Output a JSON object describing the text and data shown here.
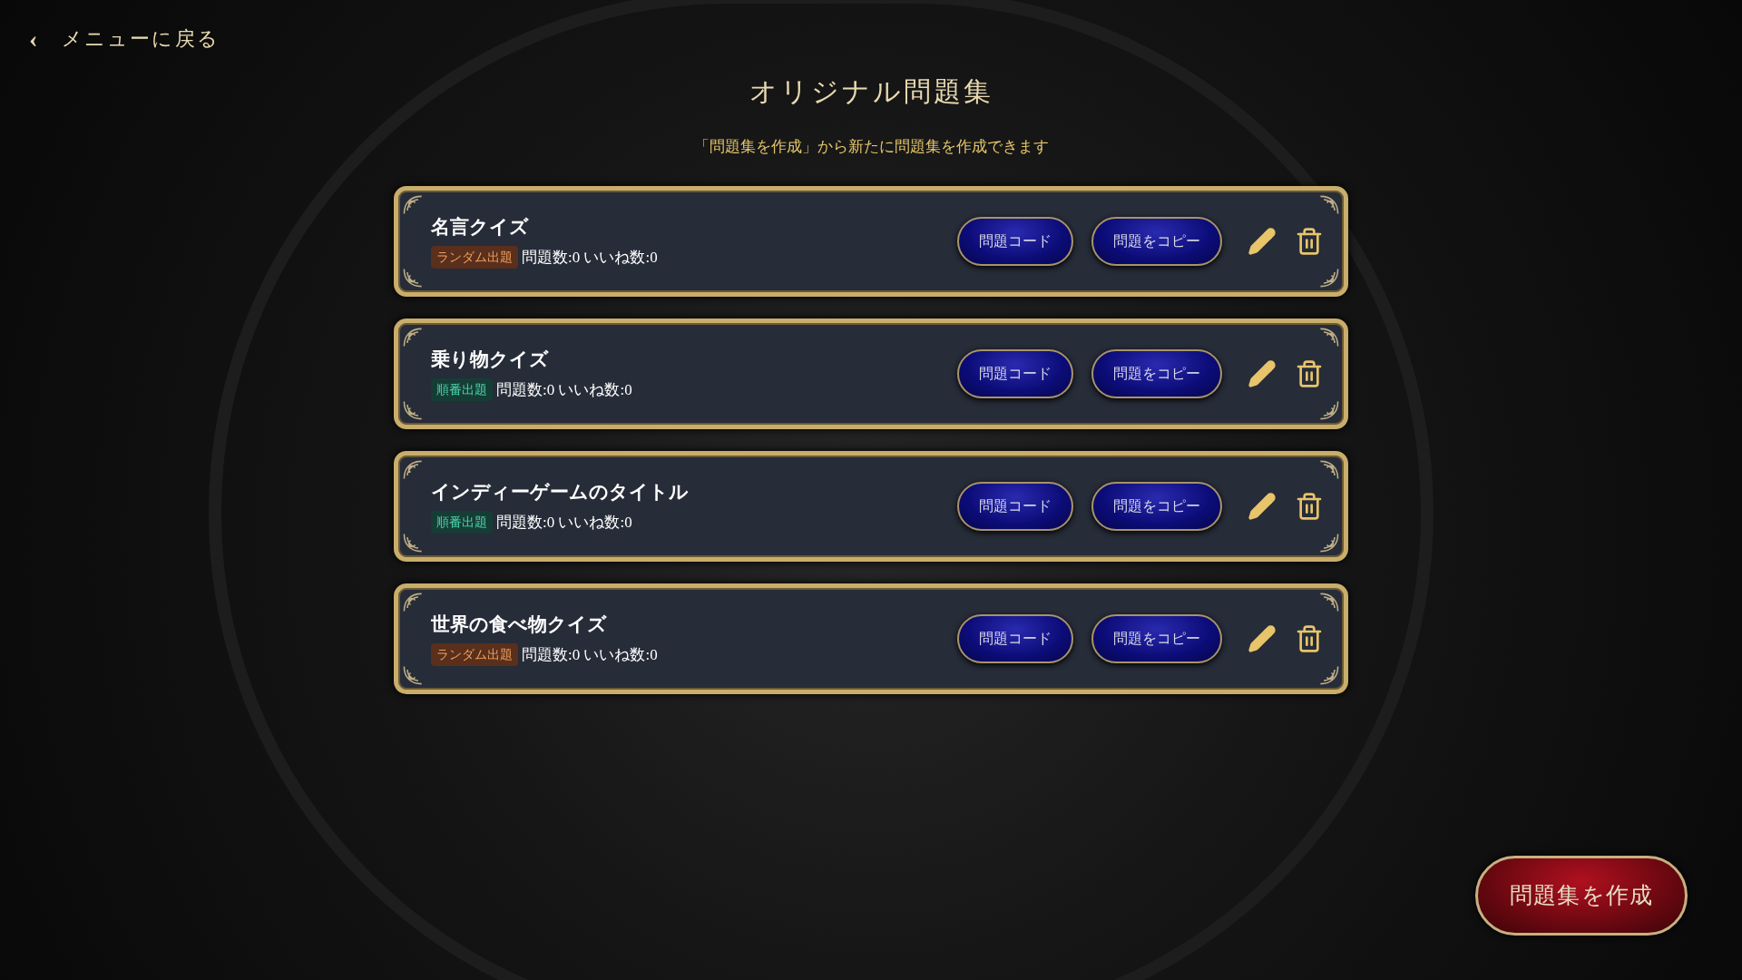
{
  "back_link": {
    "arrow": "‹",
    "label": "メニューに戻る"
  },
  "title": "オリジナル問題集",
  "subtitle": "「問題集を作成」から新たに問題集を作成できます",
  "sets": [
    {
      "name": "名言クイズ",
      "tag": {
        "label": "ランダム出題",
        "kind": "random"
      },
      "stats": "問題数:0 いいね数:0",
      "buttons": [
        "問題コード",
        "問題をコピー"
      ]
    },
    {
      "name": "乗り物クイズ",
      "tag": {
        "label": "順番出題",
        "kind": "ordered"
      },
      "stats": "問題数:0 いいね数:0",
      "buttons": [
        "問題コード",
        "問題をコピー"
      ]
    },
    {
      "name": "インディーゲームのタイトル",
      "tag": {
        "label": "順番出題",
        "kind": "ordered"
      },
      "stats": "問題数:0 いいね数:0",
      "buttons": [
        "問題コード",
        "問題をコピー"
      ]
    },
    {
      "name": "世界の食べ物クイズ",
      "tag": {
        "label": "ランダム出題",
        "kind": "random"
      },
      "stats": "問題数:0 いいね数:0",
      "buttons": [
        "問題コード",
        "問題をコピー"
      ]
    }
  ],
  "create_button": "問題集を作成"
}
